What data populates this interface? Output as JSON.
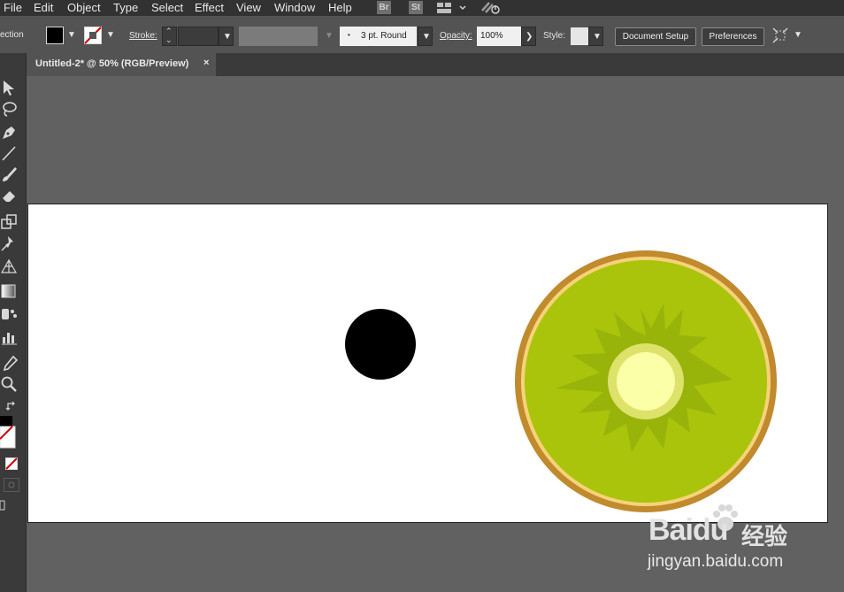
{
  "menubar": {
    "items": [
      "File",
      "Edit",
      "Object",
      "Type",
      "Select",
      "Effect",
      "View",
      "Window",
      "Help"
    ],
    "bridge": "Br",
    "stock": "St"
  },
  "control_bar": {
    "selection_label": "ection",
    "stroke_label": "Stroke:",
    "brush_value": "3 pt. Round",
    "opacity_label": "Opacity:",
    "opacity_value": "100%",
    "style_label": "Style:",
    "document_setup": "Document Setup",
    "preferences": "Preferences"
  },
  "tab": {
    "title": "Untitled-2* @ 50% (RGB/Preview)",
    "close": "×"
  },
  "watermark": {
    "brand": "Baidu",
    "brand_cn": "经验",
    "url": "jingyan.baidu.com"
  },
  "colors": {
    "kiwi_rim": "#c08a2d",
    "kiwi_ring": "#f6d27a",
    "kiwi_flesh": "#a9c40a",
    "kiwi_pattern": "#98b40a",
    "kiwi_core_outer": "#dde26a",
    "kiwi_core_inner": "#fbffa8",
    "app_background": "#535353"
  },
  "icons": [
    "selection-arrow-icon",
    "lasso-icon",
    "pen-icon",
    "line-icon",
    "brush-icon",
    "eraser-icon",
    "scale-icon",
    "puppet-pin-icon",
    "perspective-grid-icon",
    "gradient-icon",
    "symbol-sprayer-icon",
    "graph-icon",
    "eyedropper-icon",
    "zoom-icon",
    "swap-colors-icon",
    "none-color-icon"
  ]
}
